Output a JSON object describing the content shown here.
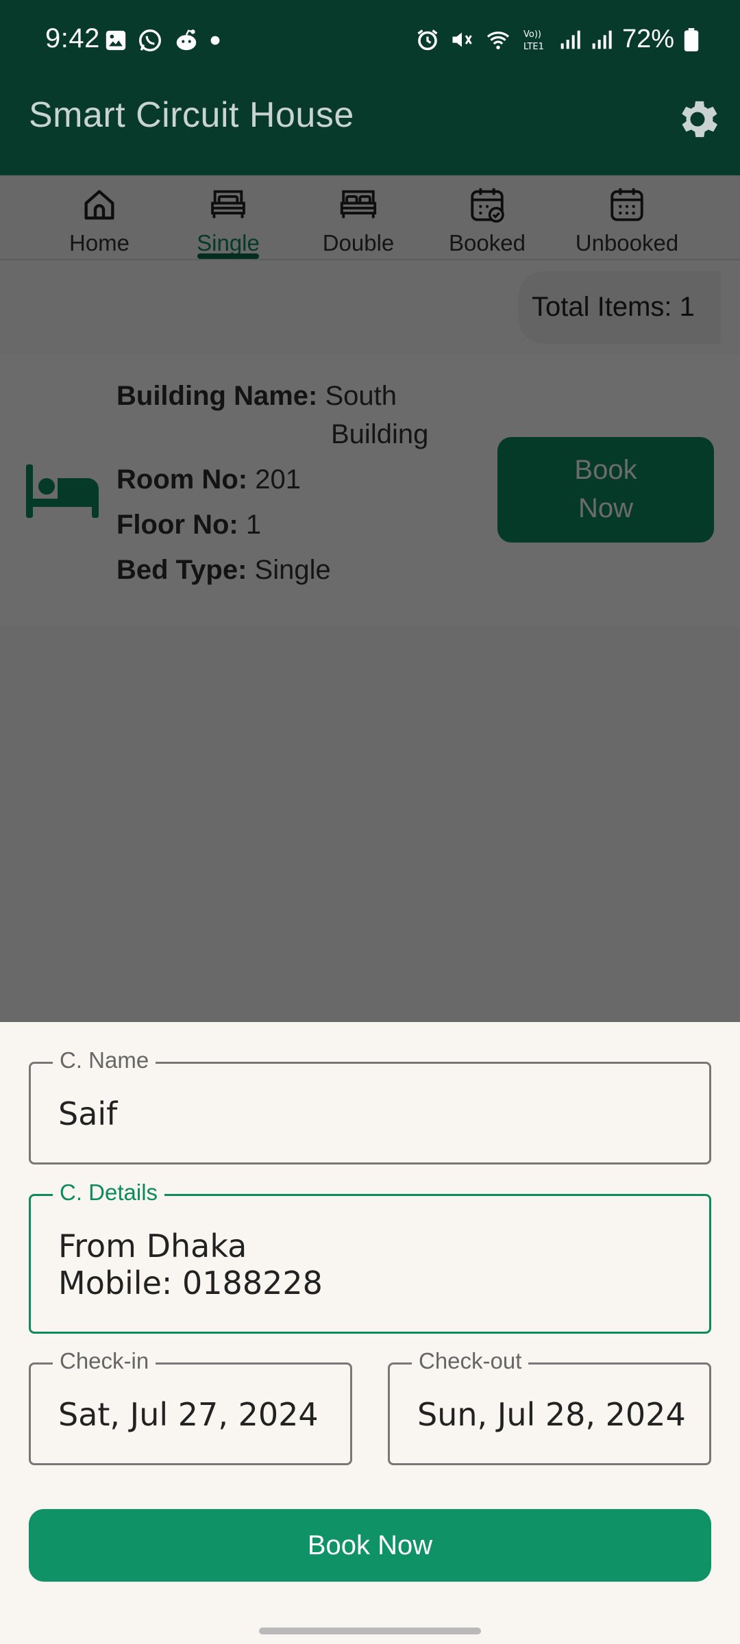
{
  "status_bar": {
    "time": "9:42",
    "battery": "72%",
    "left_icons": [
      "image-icon",
      "whatsapp-icon",
      "reddit-icon",
      "dot-icon"
    ],
    "right_icons": [
      "alarm-icon",
      "mute-icon",
      "wifi-icon",
      "volte-icon",
      "signal-icon",
      "signal-icon",
      "battery-icon"
    ]
  },
  "app_bar": {
    "title": "Smart Circuit House",
    "settings_icon": "gear-icon"
  },
  "tabs": [
    {
      "label": "Home",
      "icon": "home-icon",
      "active": false
    },
    {
      "label": "Single",
      "icon": "single-bed-icon",
      "active": true
    },
    {
      "label": "Double",
      "icon": "double-bed-icon",
      "active": false
    },
    {
      "label": "Booked",
      "icon": "calendar-check-icon",
      "active": false
    },
    {
      "label": "Unbooked",
      "icon": "calendar-icon",
      "active": false
    }
  ],
  "summary": {
    "total_items": "Total Items: 1"
  },
  "room_card": {
    "building_label": "Building Name:",
    "building_line1": "South",
    "building_line2": "Building",
    "room_label": "Room No:",
    "room_value": "201",
    "floor_label": "Floor No:",
    "floor_value": "1",
    "bed_label": "Bed Type:",
    "bed_value": "Single",
    "book_line1": "Book",
    "book_line2": "Now",
    "icon": "bed-icon"
  },
  "form": {
    "name_label": "C. Name",
    "name_value": "Saif",
    "details_label": "C. Details",
    "details_line1": "From Dhaka",
    "details_line2": "Mobile: 0188228",
    "checkin_label": "Check-in",
    "checkin_value": "Sat, Jul 27, 2024",
    "checkout_label": "Check-out",
    "checkout_value": "Sun, Jul 28, 2024",
    "submit_label": "Book Now"
  },
  "colors": {
    "primary_dark": "#073a2b",
    "primary": "#0e8a61",
    "button": "#0f9266",
    "sheet_bg": "#f9f6f1"
  }
}
